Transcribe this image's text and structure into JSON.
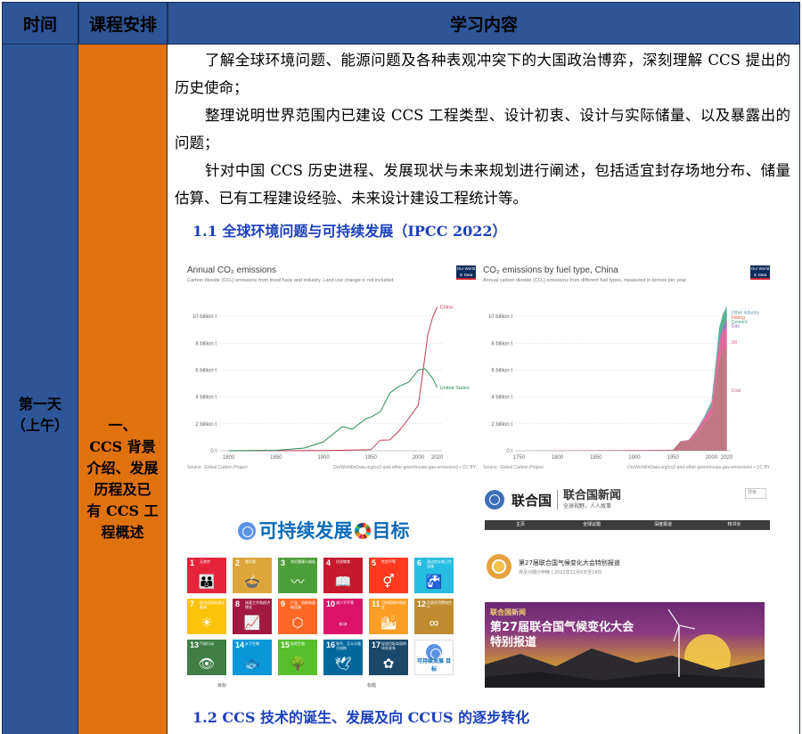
{
  "header": {
    "col_time": "时间",
    "col_schedule": "课程安排",
    "col_content": "学习内容"
  },
  "day": {
    "line1": "第一天",
    "line2": "（上午）"
  },
  "course": {
    "line1": "一、",
    "line2": "CCS 背景",
    "line3": "介绍、发展",
    "line4": "历程及已",
    "line5": "有 CCS 工",
    "line6": "程概述"
  },
  "paragraphs": [
    "了解全球环境问题、能源问题及各种表观冲突下的大国政治博弈，深刻理解 CCS 提出的历史使命；",
    "整理说明世界范围内已建设 CCS 工程类型、设计初衷、设计与实际储量、以及暴露出的问题；",
    "针对中国 CCS 历史进程、发展现状与未来规划进行阐述，包括适宜封存场地分布、储量估算、已有工程建设经验、未来设计建设工程统计等。"
  ],
  "sections": {
    "s1": "1.1  全球环境问题与可持续发展（IPCC 2022）",
    "s2": "1.2 CCS 技术的诞生、发展及向 CCUS 的逐步转化"
  },
  "chart_left": {
    "title": "Annual CO₂ emissions",
    "subtitle": "Carbon dioxide (CO₂) emissions from fossil fuels and industry. Land use change is not included.",
    "source": "Source: Global Carbon Project",
    "url": "OurWorldInData.org/co2-and-other-greenhouse-gas-emissions/ • CC BY",
    "badge": "Our World in Data"
  },
  "chart_right": {
    "title": "CO₂ emissions by fuel type, China",
    "subtitle": "Annual carbon dioxide (CO₂) emissions from different fuel types, measured in tonnes per year.",
    "source": "Source: Global Carbon Project",
    "url": "OurWorldInData.org/co2-and-other-greenhouse-gas-emissions/ • CC BY",
    "badge": "Our World in Data"
  },
  "chart_data": [
    {
      "type": "line",
      "title": "Annual CO₂ emissions",
      "ylim": [
        0,
        11
      ],
      "yticks": [
        "0 t",
        "2 billion t",
        "4 billion t",
        "6 billion t",
        "8 billion t",
        "10 billion t"
      ],
      "xticks": [
        "1800",
        "1850",
        "1900",
        "1950",
        "2000",
        "2020"
      ],
      "series": [
        {
          "name": "China",
          "color": "#c43c55",
          "x": [
            1800,
            1900,
            1950,
            1960,
            1970,
            1980,
            1990,
            2000,
            2005,
            2010,
            2015,
            2020
          ],
          "y": [
            0,
            0.01,
            0.08,
            0.78,
            0.8,
            1.5,
            2.4,
            3.4,
            5.9,
            8.6,
            9.9,
            10.7
          ]
        },
        {
          "name": "United States",
          "color": "#2e8b57",
          "x": [
            1800,
            1850,
            1880,
            1900,
            1920,
            1930,
            1945,
            1950,
            1960,
            1970,
            1980,
            1990,
            2000,
            2007,
            2015,
            2020
          ],
          "y": [
            0.0,
            0.03,
            0.2,
            0.66,
            1.8,
            1.6,
            2.4,
            2.5,
            2.9,
            4.3,
            4.8,
            5.1,
            6.0,
            6.1,
            5.4,
            4.7
          ]
        }
      ]
    },
    {
      "type": "area",
      "title": "CO₂ emissions by fuel type, China",
      "ylim": [
        0,
        11
      ],
      "yticks": [
        "0 t",
        "2 billion t",
        "4 billion t",
        "6 billion t",
        "8 billion t",
        "10 billion t"
      ],
      "xticks": [
        "1750",
        "1800",
        "1850",
        "1900",
        "1950",
        "2000",
        "2020"
      ],
      "x": [
        1750,
        1950,
        1960,
        1970,
        1980,
        1990,
        2000,
        2005,
        2010,
        2015,
        2020
      ],
      "series": [
        {
          "name": "Coal",
          "color": "#b5606f",
          "values": [
            0,
            0.07,
            0.7,
            0.7,
            1.2,
            2.0,
            2.7,
            4.8,
            6.8,
            7.5,
            7.6
          ]
        },
        {
          "name": "Oil",
          "color": "#d94f8a",
          "values": [
            0,
            0,
            0.02,
            0.08,
            0.25,
            0.35,
            0.6,
            0.9,
            1.3,
            1.4,
            1.6
          ]
        },
        {
          "name": "Gas",
          "color": "#8a5aa8",
          "values": [
            0,
            0,
            0,
            0.01,
            0.03,
            0.04,
            0.06,
            0.1,
            0.2,
            0.35,
            0.6
          ]
        },
        {
          "name": "Cement",
          "color": "#3aa67f",
          "values": [
            0,
            0,
            0,
            0.01,
            0.04,
            0.1,
            0.3,
            0.5,
            0.8,
            0.9,
            0.85
          ]
        },
        {
          "name": "Flaring",
          "color": "#e0603a",
          "values": [
            0,
            0,
            0,
            0,
            0,
            0,
            0,
            0,
            0.01,
            0.01,
            0.01
          ]
        },
        {
          "name": "Other industry",
          "color": "#5b8aa8",
          "values": [
            0,
            0,
            0,
            0,
            0,
            0,
            0.01,
            0.02,
            0.05,
            0.08,
            0.1
          ]
        }
      ]
    }
  ],
  "sdg": {
    "title_prefix": "可持续发展",
    "title_suffix": "目标",
    "caption_left": "目标",
    "caption_right": "标题",
    "tiles": [
      {
        "n": "1",
        "label": "无贫穷",
        "color": "#e5243b",
        "glyph": "👪"
      },
      {
        "n": "2",
        "label": "零饥饿",
        "color": "#dda63a",
        "glyph": "🍲"
      },
      {
        "n": "3",
        "label": "良好健康与福祉",
        "color": "#4c9f38",
        "glyph": "〰"
      },
      {
        "n": "4",
        "label": "优质教育",
        "color": "#c5192d",
        "glyph": "📖"
      },
      {
        "n": "5",
        "label": "性别平等",
        "color": "#ff3a21",
        "glyph": "⚥"
      },
      {
        "n": "6",
        "label": "清洁饮水和卫生设施",
        "color": "#26bde2",
        "glyph": "🚰"
      },
      {
        "n": "7",
        "label": "经济适用的清洁能源",
        "color": "#fcc30b",
        "glyph": "☀"
      },
      {
        "n": "8",
        "label": "体面工作和经济增长",
        "color": "#a21942",
        "glyph": "📈"
      },
      {
        "n": "9",
        "label": "产业、创新和基础设施",
        "color": "#fd6925",
        "glyph": "⬡"
      },
      {
        "n": "10",
        "label": "减少不平等",
        "color": "#dd1367",
        "glyph": "⇔"
      },
      {
        "n": "11",
        "label": "可持续城市和社区",
        "color": "#fd9d24",
        "glyph": "🏙"
      },
      {
        "n": "12",
        "label": "负责任消费和生产",
        "color": "#bf8b2e",
        "glyph": "∞"
      },
      {
        "n": "13",
        "label": "气候行动",
        "color": "#3f7e44",
        "glyph": "👁"
      },
      {
        "n": "14",
        "label": "水下生物",
        "color": "#0a97d9",
        "glyph": "🐟"
      },
      {
        "n": "15",
        "label": "陆地生物",
        "color": "#56c02b",
        "glyph": "🌳"
      },
      {
        "n": "16",
        "label": "和平、正义与强大机构",
        "color": "#00689d",
        "glyph": "🕊"
      },
      {
        "n": "17",
        "label": "促进目标实现的伙伴关系",
        "color": "#19486a",
        "glyph": "✿"
      }
    ],
    "logo_text_1": "可持续发展",
    "logo_text_2": "目标"
  },
  "un_news": {
    "org": "联合国",
    "site": "联合国新闻",
    "tagline": "全球视野，人人故事",
    "search": "搜索",
    "nav": [
      "主页",
      "全球议题",
      "深度报道",
      "特书长"
    ],
    "special_title": "第27届联合国气候变化大会特别报道",
    "special_sub": "埃及沙姆沙伊赫 | 2022年11月6日至18日",
    "banner_tag": "联合国新闻",
    "banner_title_1": "第27届联合国气候变化大会",
    "banner_title_2": "特别报道"
  }
}
